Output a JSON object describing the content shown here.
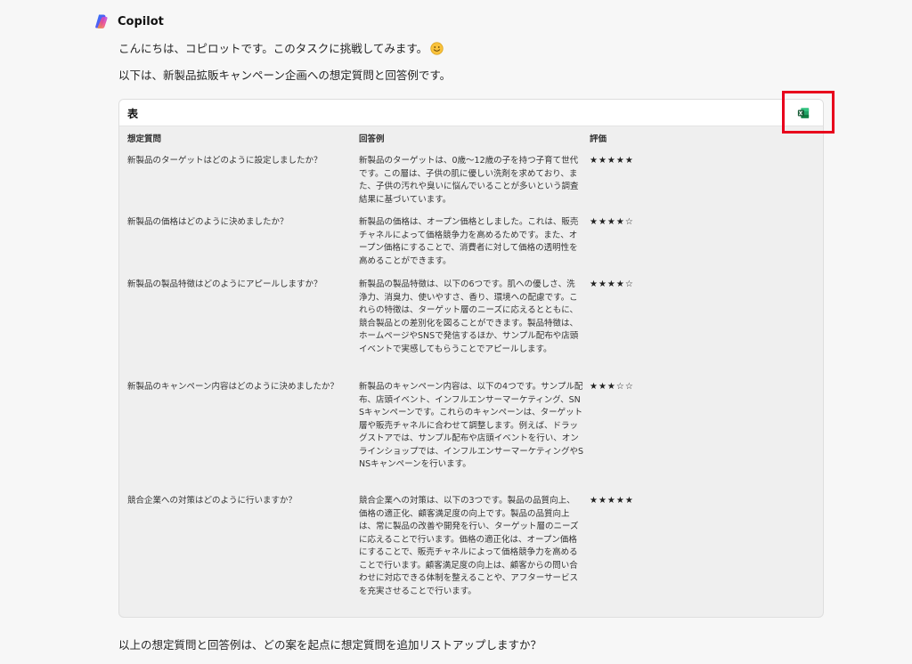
{
  "assistant": {
    "name": "Copilot",
    "logo_icon": "copilot-logo-icon"
  },
  "messages": {
    "greeting": "こんにちは、コピロットです。このタスクに挑戦してみます。",
    "greeting_emoji_icon": "smiling-face-icon",
    "intro": "以下は、新製品拡販キャンペーン企画への想定質問と回答例です。",
    "footer": "以上の想定質問と回答例は、どの案を起点に想定質問を追加リストアップしますか？"
  },
  "table": {
    "title": "表",
    "export_icon": "excel-icon",
    "headers": {
      "question": "想定質問",
      "answer": "回答例",
      "rating": "評価"
    },
    "rows": [
      {
        "question": "新製品のターゲットはどのように設定しましたか？",
        "answer": "新製品のターゲットは、0歳〜12歳の子を持つ子育て世代です。この層は、子供の肌に優しい洗剤を求めており、また、子供の汚れや臭いに悩んでいることが多いという調査結果に基づいています。",
        "rating": "★★★★★"
      },
      {
        "question": "新製品の価格はどのように決めましたか？",
        "answer": "新製品の価格は、オープン価格としました。これは、販売チャネルによって価格競争力を高めるためです。また、オープン価格にすることで、消費者に対して価格の透明性を高めることができます。",
        "rating": "★★★★☆"
      },
      {
        "question": "新製品の製品特徴はどのようにアピールしますか？",
        "answer": "新製品の製品特徴は、以下の6つです。肌への優しさ、洗浄力、消臭力、使いやすさ、香り、環境への配慮です。これらの特徴は、ターゲット層のニーズに応えるとともに、競合製品との差別化を図ることができます。製品特徴は、ホームページやSNSで発信するほか、サンプル配布や店頭イベントで実感してもらうことでアピールします。",
        "rating": "★★★★☆"
      },
      {
        "question": "新製品のキャンペーン内容はどのように決めましたか？",
        "answer": "新製品のキャンペーン内容は、以下の4つです。サンプル配布、店頭イベント、インフルエンサーマーケティング、SNSキャンペーンです。これらのキャンペーンは、ターゲット層や販売チャネルに合わせて調整します。例えば、ドラッグストアでは、サンプル配布や店頭イベントを行い、オンラインショップでは、インフルエンサーマーケティングやSNSキャンペーンを行います。",
        "rating": "★★★☆☆"
      },
      {
        "question": "競合企業への対策はどのように行いますか？",
        "answer": "競合企業への対策は、以下の3つです。製品の品質向上、価格の適正化、顧客満足度の向上です。製品の品質向上は、常に製品の改善や開発を行い、ターゲット層のニーズに応えることで行います。価格の適正化は、オープン価格にすることで、販売チャネルによって価格競争力を高めることで行います。顧客満足度の向上は、顧客からの問い合わせに対応できる体制を整えることや、アフターサービスを充実させることで行います。",
        "rating": "★★★★★"
      }
    ]
  },
  "colors": {
    "highlight": "#e8001c",
    "excel_green": "#1d6f42"
  }
}
